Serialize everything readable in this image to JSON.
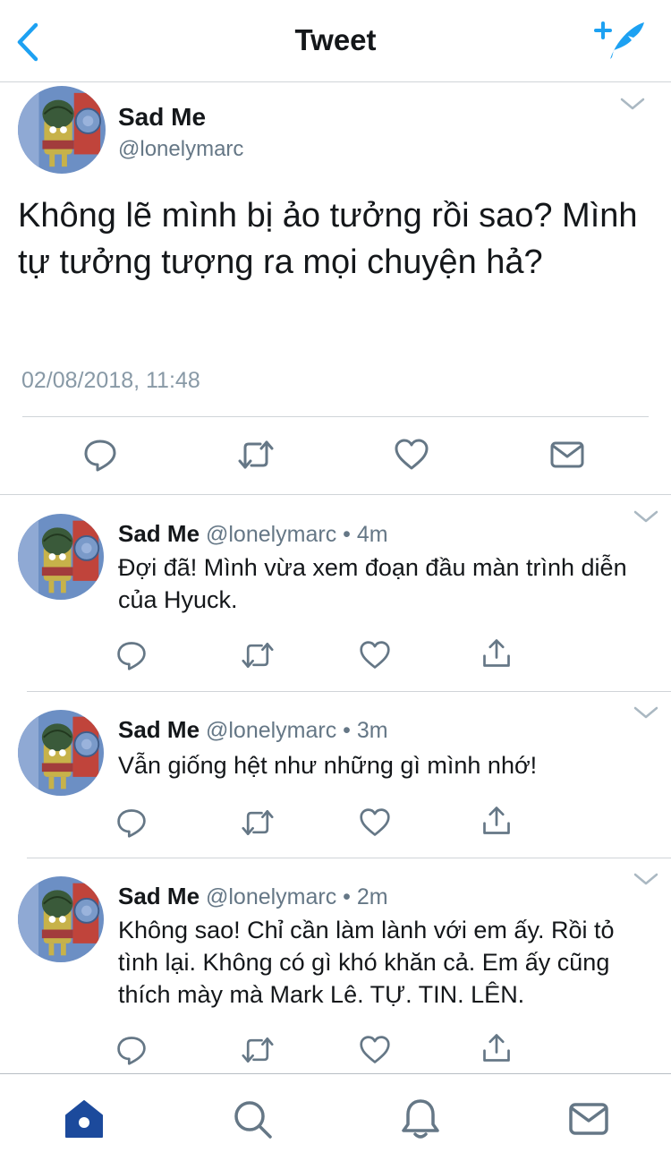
{
  "header": {
    "title": "Tweet",
    "back_icon": "chevron-left-icon",
    "compose_icon": "compose-tweet-icon"
  },
  "colors": {
    "accent": "#1da1f2",
    "text": "#14171a",
    "secondary": "#657786",
    "muted": "#8899a6",
    "icon": "#657786",
    "home_active": "#1c4a9c"
  },
  "main_tweet": {
    "name": "Sad Me",
    "handle": "@lonelymarc",
    "text": "Không lẽ mình bị ảo tưởng rồi sao? Mình tự tưởng tượng ra mọi chuyện hả?",
    "timestamp": "02/08/2018, 11:48",
    "actions": [
      "reply-icon",
      "retweet-icon",
      "like-icon",
      "direct-message-icon"
    ]
  },
  "replies": [
    {
      "name": "Sad Me",
      "meta": "@lonelymarc • 4m",
      "text": "Đợi đã! Mình vừa xem đoạn đầu màn trình diễn của Hyuck."
    },
    {
      "name": "Sad Me",
      "meta": "@lonelymarc • 3m",
      "text": "Vẫn giống hệt như những gì mình nhớ!"
    },
    {
      "name": "Sad Me",
      "meta": "@lonelymarc • 2m",
      "text": "Không sao! Chỉ cần làm lành với em ấy. Rồi tỏ tình lại. Không có gì khó khăn cả. Em ấy cũng thích mày mà Mark Lê. TỰ. TIN. LÊN."
    }
  ],
  "tabbar": {
    "items": [
      "home-icon",
      "search-icon",
      "notifications-icon",
      "messages-icon"
    ],
    "active": "home-icon"
  }
}
